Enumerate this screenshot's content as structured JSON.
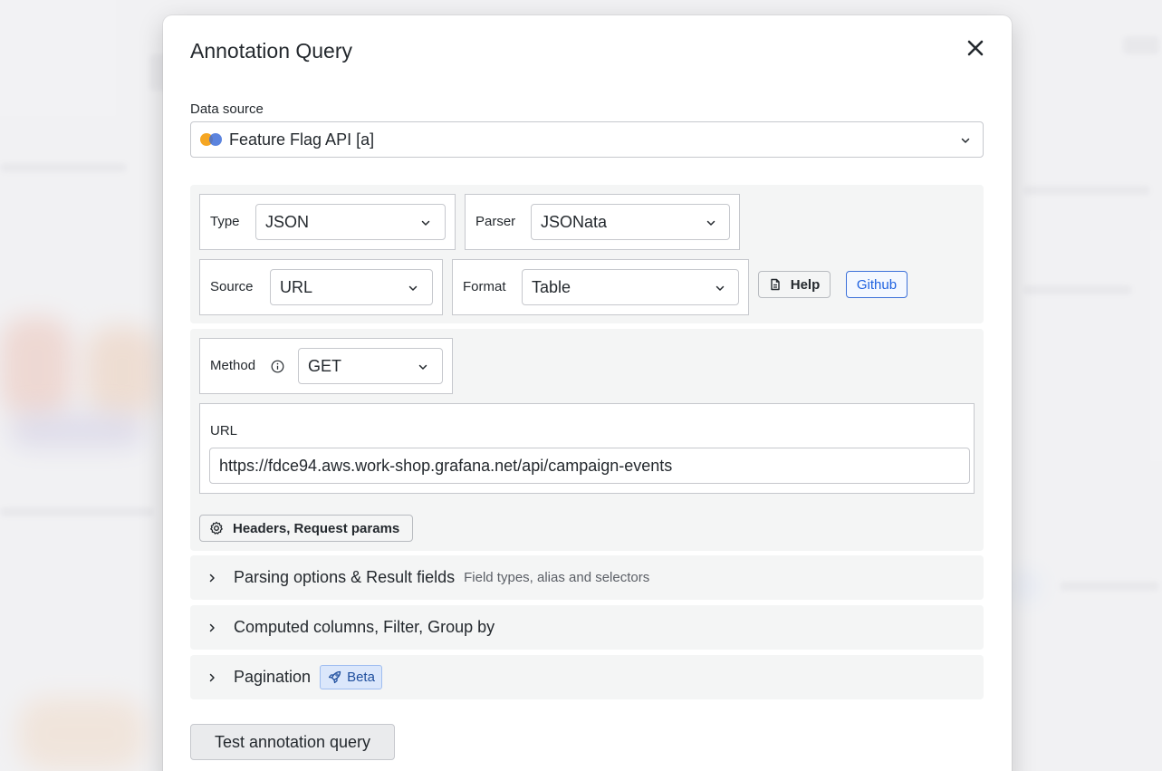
{
  "modal": {
    "title": "Annotation Query"
  },
  "datasource": {
    "label": "Data source",
    "value": "Feature Flag API [a]",
    "logo_colors": [
      "#f5a623",
      "#3f6fd8"
    ]
  },
  "query": {
    "type": {
      "label": "Type",
      "value": "JSON"
    },
    "parser": {
      "label": "Parser",
      "value": "JSONata"
    },
    "source": {
      "label": "Source",
      "value": "URL"
    },
    "format": {
      "label": "Format",
      "value": "Table"
    },
    "help_label": "Help",
    "github_label": "Github",
    "method": {
      "label": "Method",
      "value": "GET",
      "info_icon": "info-circle-icon"
    },
    "url": {
      "label": "URL",
      "value": "https://fdce94.aws.work-shop.grafana.net/api/campaign-events"
    },
    "headers_button_label": "Headers, Request params"
  },
  "sections": [
    {
      "title": "Parsing options & Result fields",
      "description": "Field types, alias and selectors"
    },
    {
      "title": "Computed columns, Filter, Group by"
    },
    {
      "title": "Pagination",
      "badge": "Beta"
    }
  ],
  "actions": {
    "test_label": "Test annotation query"
  },
  "colors": {
    "accent": "#1f62e0",
    "panel_bg": "#f4f5f5",
    "border": "#c6c8cd"
  }
}
